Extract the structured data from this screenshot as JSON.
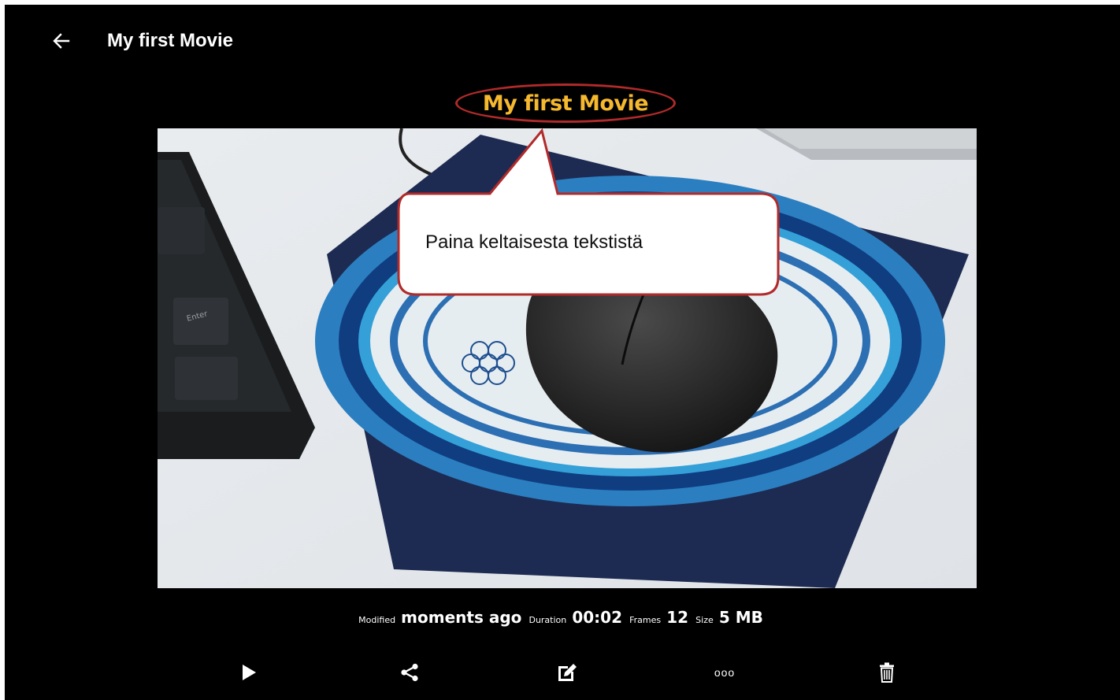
{
  "header": {
    "back_icon": "arrow-left-icon",
    "title": "My first Movie"
  },
  "movie": {
    "title": "My first Movie"
  },
  "callout": {
    "text": "Paina keltaisesta tekstistä",
    "border_color": "#b22a2a"
  },
  "meta": {
    "modified_label": "Modified",
    "modified_value": "moments ago",
    "duration_label": "Duration",
    "duration_value": "00:02",
    "frames_label": "Frames",
    "frames_value": "12",
    "size_label": "Size",
    "size_value": "5 MB"
  },
  "actions": [
    {
      "icon": "play-icon"
    },
    {
      "icon": "share-icon"
    },
    {
      "icon": "edit-icon"
    },
    {
      "icon": "more-icon",
      "label": "ooo"
    },
    {
      "icon": "trash-icon"
    }
  ],
  "colors": {
    "title_accent": "#f5b82e",
    "background": "#000000"
  }
}
